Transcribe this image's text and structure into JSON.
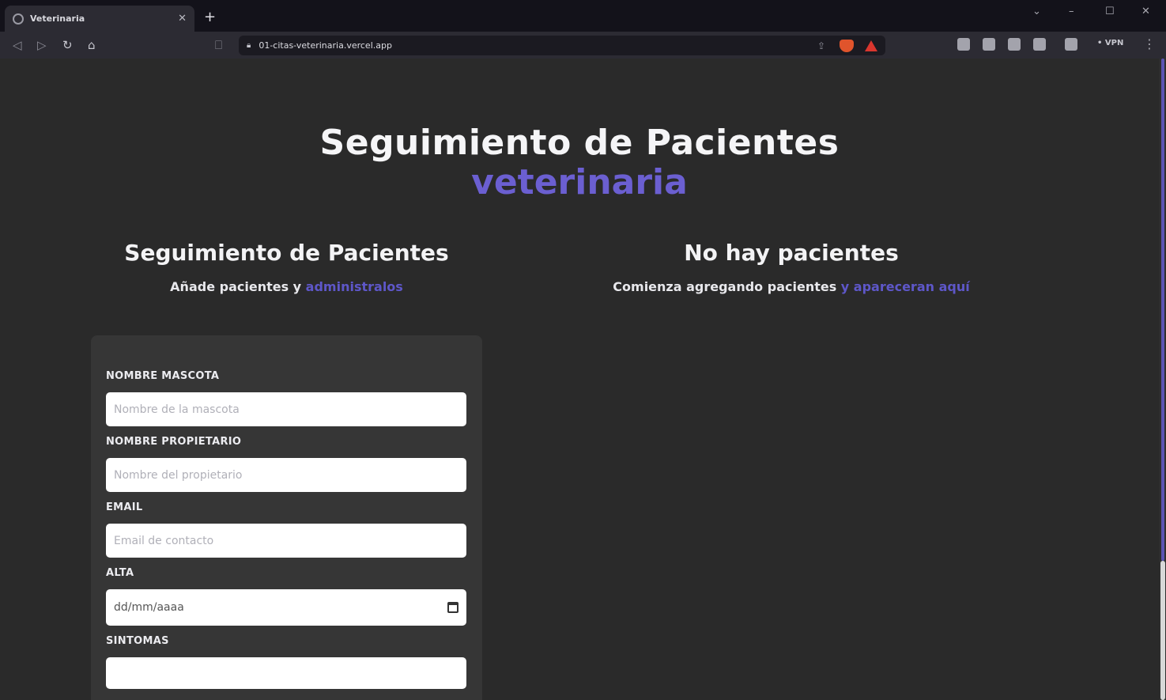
{
  "browser": {
    "tab_title": "Veterinaria",
    "tab_close": "✕",
    "new_tab": "+",
    "url": "01-citas-veterinaria.vercel.app",
    "vpn_label": "• VPN",
    "window_controls": {
      "dropdown": "⌄",
      "minimize": "–",
      "maximize": "☐",
      "close": "✕"
    }
  },
  "hero": {
    "title": "Seguimiento de Pacientes",
    "accent": "veterinaria"
  },
  "left_panel": {
    "title": "Seguimiento de Pacientes",
    "subtitle_prefix": "Añade pacientes y ",
    "subtitle_accent": "administralos"
  },
  "right_panel": {
    "title": "No hay pacientes",
    "subtitle_prefix": "Comienza agregando pacientes ",
    "subtitle_accent": "y apareceran aquí"
  },
  "form": {
    "pet_name": {
      "label": "NOMBRE MASCOTA",
      "placeholder": "Nombre de la mascota"
    },
    "owner_name": {
      "label": "NOMBRE PROPIETARIO",
      "placeholder": "Nombre del propietario"
    },
    "email": {
      "label": "EMAIL",
      "placeholder": "Email de contacto"
    },
    "discharge": {
      "label": "ALTA",
      "value": "dd/mm/aaaa"
    },
    "symptoms": {
      "label": "SINTOMAS"
    }
  },
  "colors": {
    "accent": "#6b5fd1",
    "page_bg": "#2a2a2a",
    "card_bg": "#363636"
  }
}
